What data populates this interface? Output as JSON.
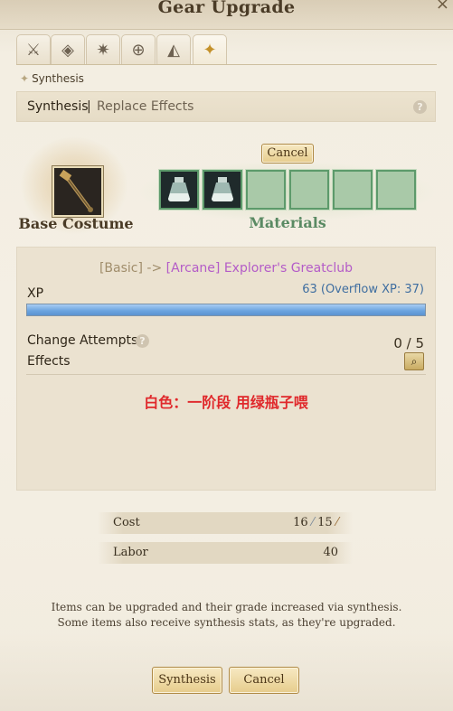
{
  "window": {
    "title": "Gear Upgrade",
    "close_glyph": "×"
  },
  "tabs": [
    {
      "icon": "crossed-swords-icon",
      "glyph": "⚔",
      "active": false
    },
    {
      "icon": "compass-icon",
      "glyph": "◈",
      "active": false
    },
    {
      "icon": "snowflake-icon",
      "glyph": "✷",
      "active": false
    },
    {
      "icon": "costume-plus-icon",
      "glyph": "⊕",
      "active": false
    },
    {
      "icon": "sail-icon",
      "glyph": "◭",
      "active": false
    },
    {
      "icon": "sword-upgrade-icon",
      "glyph": "✦",
      "active": true
    }
  ],
  "breadcrumb": {
    "marker": "✦",
    "label": "Synthesis"
  },
  "subtabs": {
    "synthesis": "Synthesis",
    "separator": "|",
    "replace_effects": "Replace Effects",
    "help": "?"
  },
  "base": {
    "label": "Base Costume",
    "item_icon": "greatclub-icon"
  },
  "materials": {
    "label": "Materials",
    "cancel": "Cancel",
    "slots": [
      {
        "filled": true,
        "icon": "potion-icon",
        "glyph": "⚗"
      },
      {
        "filled": true,
        "icon": "potion-icon",
        "glyph": "⚗"
      },
      {
        "filled": false
      },
      {
        "filled": false
      },
      {
        "filled": false
      },
      {
        "filled": false
      }
    ]
  },
  "details": {
    "from_grade": "[Basic]",
    "arrow": "->",
    "to_item": "[Arcane] Explorer's Greatclub",
    "xp_label": "XP",
    "xp_value": "63 (Overflow XP: 37)",
    "xp_fill_fraction": 1.0,
    "change_attempts_label": "Change Attempts",
    "change_attempts_help": "?",
    "change_attempts_value": "0 / 5",
    "effects_label": "Effects",
    "effects_note": "白色：一阶段 用绿瓶子喂"
  },
  "cost": {
    "label": "Cost",
    "value1": "16",
    "value2": "15",
    "labor_label": "Labor",
    "labor_value": "40"
  },
  "info": {
    "line1": "Items can be upgraded and their grade increased via synthesis.",
    "line2": "Some items also receive synthesis stats, as they're upgraded."
  },
  "actions": {
    "synthesis": "Synthesis",
    "cancel": "Cancel"
  },
  "colors": {
    "accent_gold": "#c4912b",
    "arcane_purple": "#b45cc8",
    "note_red": "#e0282b",
    "materials_green": "#5a8a63",
    "xp_blue": "#3f6ea0"
  }
}
